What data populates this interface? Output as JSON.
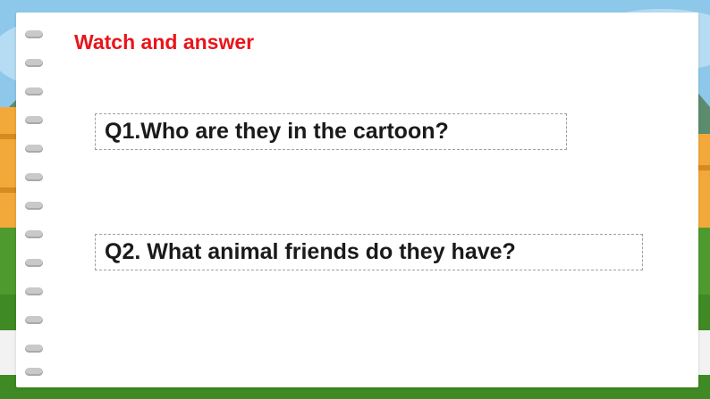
{
  "slide": {
    "heading": "Watch and answer",
    "questions": [
      {
        "text": "Q1.Who are they in the cartoon?"
      },
      {
        "text": "Q2. What animal friends do they have?"
      }
    ]
  },
  "colors": {
    "heading": "#e8151b",
    "sky": "#8dc8ea",
    "grass": "#4f9a2e",
    "fence": "#f3a93a",
    "paper": "#ffffff"
  }
}
